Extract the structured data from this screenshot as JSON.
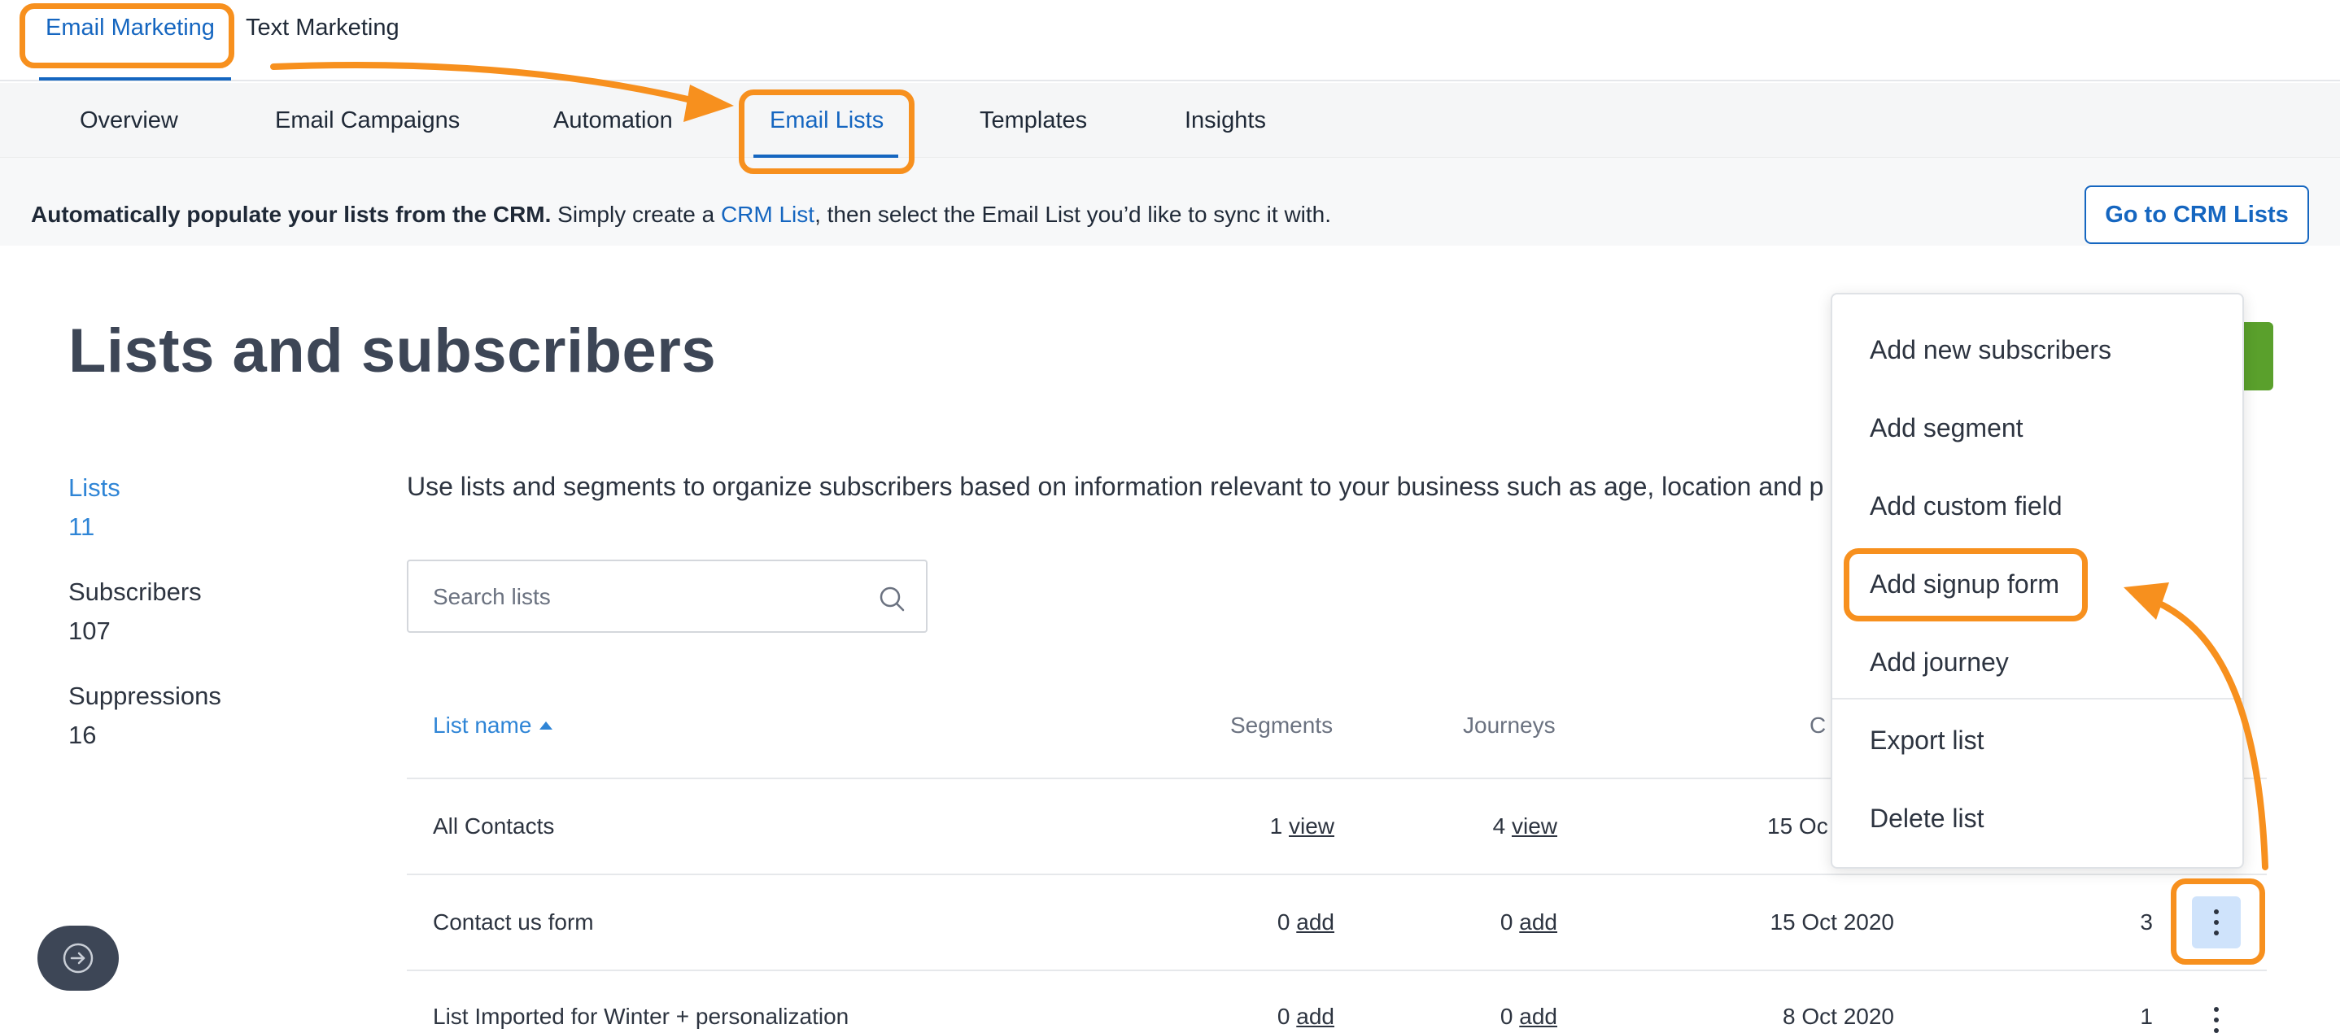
{
  "top_tabs": [
    {
      "label": "Email Marketing",
      "active": true
    },
    {
      "label": "Text Marketing",
      "active": false
    }
  ],
  "sub_nav": [
    {
      "label": "Overview"
    },
    {
      "label": "Email Campaigns"
    },
    {
      "label": "Automation"
    },
    {
      "label": "Email Lists",
      "active": true
    },
    {
      "label": "Templates"
    },
    {
      "label": "Insights"
    }
  ],
  "banner": {
    "bold": "Automatically populate your lists from the CRM.",
    "pre": " Simply create a ",
    "link": "CRM List",
    "post": ", then select the Email List you’d like to sync it with.",
    "button": "Go to CRM Lists"
  },
  "page_title": "Lists and subscribers",
  "stats": [
    {
      "label": "Lists",
      "value": "11"
    },
    {
      "label": "Subscribers",
      "value": "107"
    },
    {
      "label": "Suppressions",
      "value": "16"
    }
  ],
  "intro": "Use lists and segments to organize subscribers based on information relevant to your business such as age, location and p",
  "search": {
    "placeholder": "Search lists"
  },
  "table": {
    "headers": {
      "name": "List name",
      "segments": "Segments",
      "journeys": "Journeys",
      "created": "C"
    },
    "rows": [
      {
        "name": "All Contacts",
        "seg_count": "1",
        "seg_link": "view",
        "jour_count": "4",
        "jour_link": "view",
        "date": "15 Oc",
        "count": ""
      },
      {
        "name": "Contact us form",
        "seg_count": "0",
        "seg_link": "add",
        "jour_count": "0",
        "jour_link": "add",
        "date": "15 Oct 2020",
        "count": "3"
      },
      {
        "name": "List Imported for Winter + personalization",
        "seg_count": "0",
        "seg_link": "add",
        "jour_count": "0",
        "jour_link": "add",
        "date": "8 Oct 2020",
        "count": "1"
      }
    ]
  },
  "menu": [
    {
      "label": "Add new subscribers"
    },
    {
      "label": "Add segment"
    },
    {
      "label": "Add custom field"
    },
    {
      "label": "Add signup form"
    },
    {
      "label": "Add journey"
    },
    {
      "label": "Export list"
    },
    {
      "label": "Delete list"
    }
  ],
  "colors": {
    "accent": "#1566c0",
    "highlight": "#f7901e",
    "primary_green": "#5aa02c"
  },
  "icons": {
    "search": "search-icon",
    "help": "arrow-right-circle-icon",
    "more": "kebab-icon"
  }
}
